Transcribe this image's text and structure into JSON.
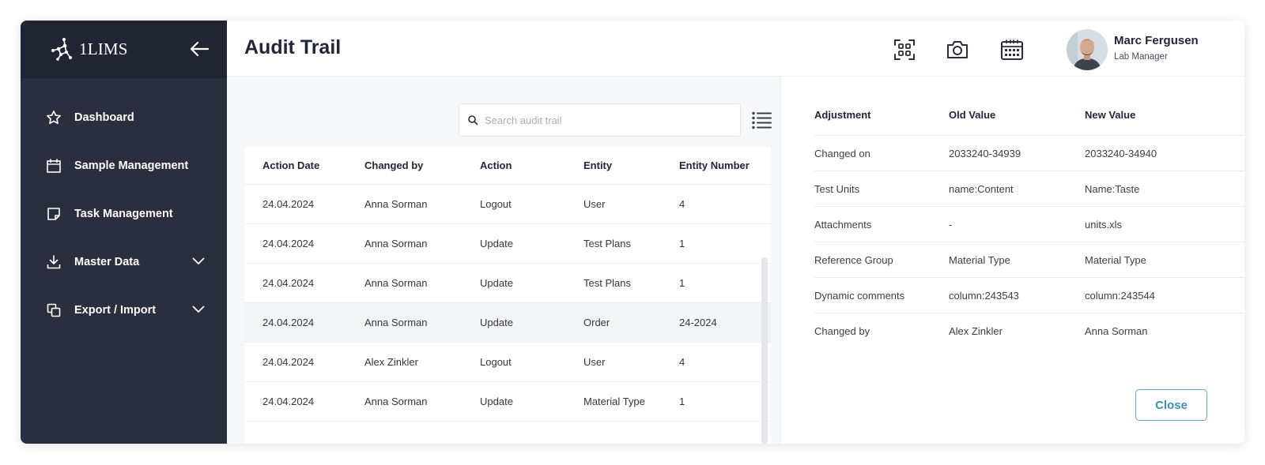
{
  "app": {
    "brand": "1LIMS"
  },
  "sidebar": {
    "items": [
      {
        "label": "Dashboard",
        "icon": "star-icon",
        "expandable": false
      },
      {
        "label": "Sample Management",
        "icon": "calendar-icon",
        "expandable": false
      },
      {
        "label": "Task Management",
        "icon": "note-icon",
        "expandable": false
      },
      {
        "label": "Master Data",
        "icon": "download-icon",
        "expandable": true
      },
      {
        "label": "Export / Import",
        "icon": "copy-icon",
        "expandable": true
      }
    ]
  },
  "header": {
    "title": "Audit Trail",
    "icons": [
      "qr-scan-icon",
      "camera-icon",
      "calendar-grid-icon"
    ],
    "user": {
      "name": "Marc Fergusen",
      "role": "Lab Manager"
    }
  },
  "search": {
    "placeholder": "Search audit trail",
    "value": ""
  },
  "audit_table": {
    "columns": [
      "Action Date",
      "Changed by",
      "Action",
      "Entity",
      "Entity Number"
    ],
    "rows": [
      [
        "24.04.2024",
        "Anna Sorman",
        "Logout",
        "User",
        "4"
      ],
      [
        "24.04.2024",
        "Anna Sorman",
        "Update",
        "Test Plans",
        "1"
      ],
      [
        "24.04.2024",
        "Anna Sorman",
        "Update",
        "Test Plans",
        "1"
      ],
      [
        "24.04.2024",
        "Anna Sorman",
        "Update",
        "Order",
        "24-2024"
      ],
      [
        "24.04.2024",
        "Alex Zinkler",
        "Logout",
        "User",
        "4"
      ],
      [
        "24.04.2024",
        "Anna Sorman",
        "Update",
        "Material Type",
        "1"
      ]
    ],
    "selected_row": 3
  },
  "detail": {
    "columns": [
      "Adjustment",
      "Old Value",
      "New Value"
    ],
    "rows": [
      [
        "Changed on",
        "2033240-34939",
        "2033240-34940"
      ],
      [
        "Test Units",
        "name:Content",
        "Name:Taste"
      ],
      [
        "Attachments",
        "-",
        "units.xls"
      ],
      [
        "Reference Group",
        "Material Type",
        "Material Type"
      ],
      [
        "Dynamic comments",
        "column:243543",
        "column:243544"
      ],
      [
        "Changed by",
        "Alex Zinkler",
        "Anna Sorman"
      ]
    ],
    "close_label": "Close"
  },
  "colors": {
    "sidebar_bg": "#2b2e3e",
    "sidebar_head_bg": "#222534",
    "accent": "#3f8fb5",
    "content_bg": "#f6f7f9"
  }
}
